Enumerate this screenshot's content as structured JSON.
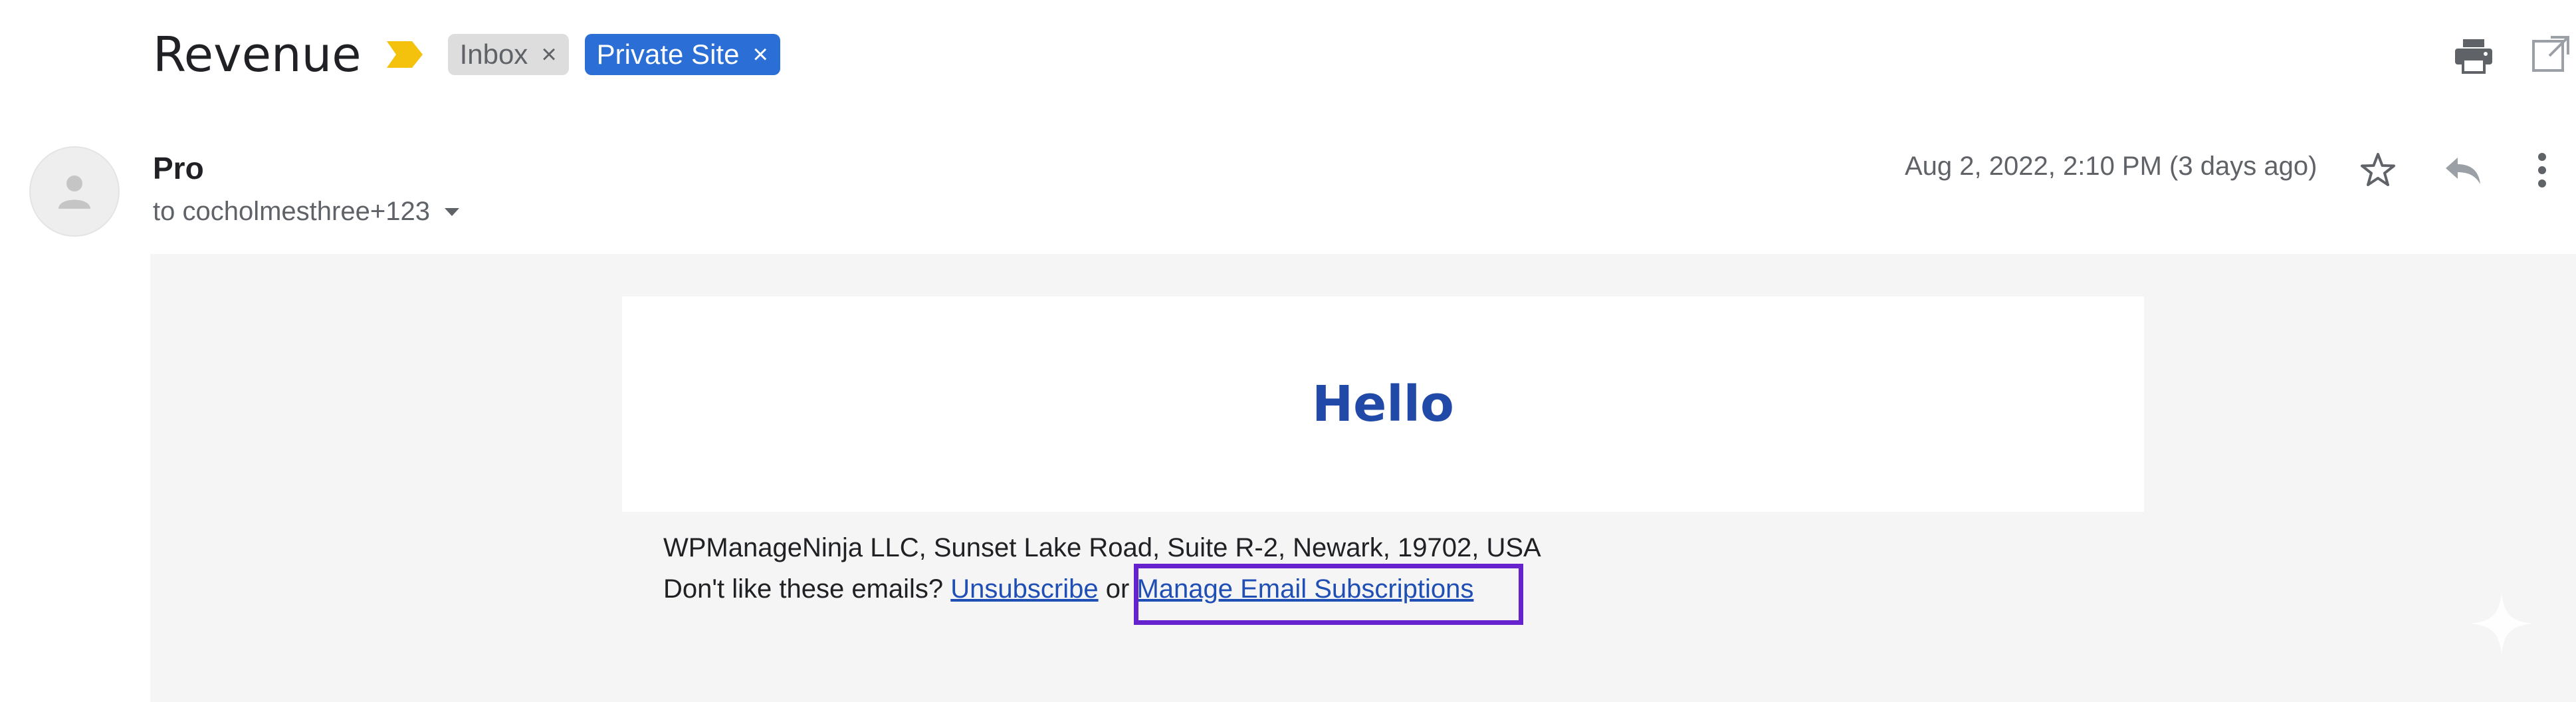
{
  "header": {
    "subject": "Revenue",
    "labels": [
      {
        "text": "Inbox",
        "remove": "×"
      },
      {
        "text": "Private Site",
        "remove": "×"
      }
    ],
    "icons": [
      "important-marker-icon",
      "print-icon",
      "open-in-new-window-icon"
    ]
  },
  "message": {
    "sender": "Pro",
    "recipients": "to cocholmesthree+123",
    "date": "Aug 2, 2022, 2:10 PM (3 days ago)",
    "icons": [
      "avatar-icon",
      "star-icon",
      "reply-icon",
      "more-options-icon",
      "recipients-dropdown-icon"
    ]
  },
  "body": {
    "greeting": "Hello",
    "address": "WPManageNinja LLC, Sunset Lake Road, Suite R-2, Newark, 19702, USA",
    "prompt": "Don't like these emails?",
    "unsubscribe": "Unsubscribe",
    "or": "or",
    "manage": "Manage Email Subscriptions"
  },
  "colors": {
    "accent_chip": "#2b6fd6",
    "link": "#1f4fb5",
    "greeting": "#2149a8",
    "highlight": "#6622cc",
    "importance": "#f4c20d"
  }
}
